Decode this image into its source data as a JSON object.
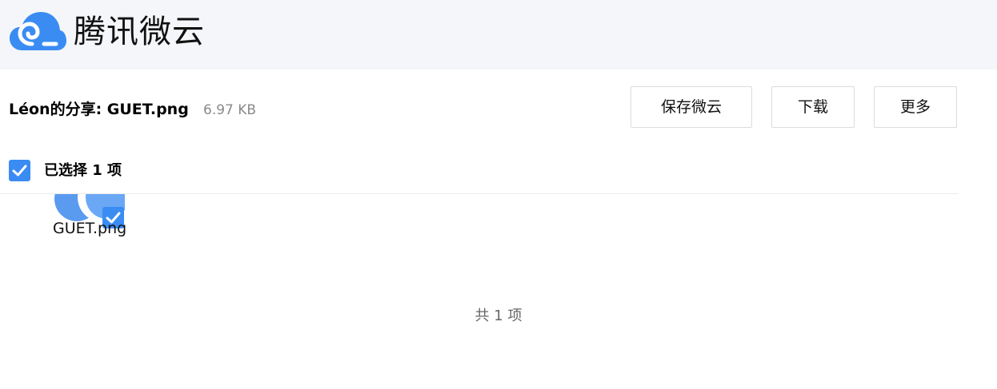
{
  "header": {
    "logo_icon": "cloud-logo-icon",
    "app_name": "腾讯微云",
    "background": "#f4f6f9",
    "accent": "#3a8cf3"
  },
  "share": {
    "title": "Léon的分享: GUET.png",
    "size": "6.97 KB"
  },
  "toolbar": {
    "save_label": "保存微云",
    "download_label": "下载",
    "more_label": "更多"
  },
  "selection": {
    "label": "已选择 1 项",
    "checked": true
  },
  "files": [
    {
      "name": "GUET.png",
      "selected": true,
      "icon": "image-thumbnail-icon"
    }
  ],
  "footer": {
    "total": "共 1 项"
  }
}
